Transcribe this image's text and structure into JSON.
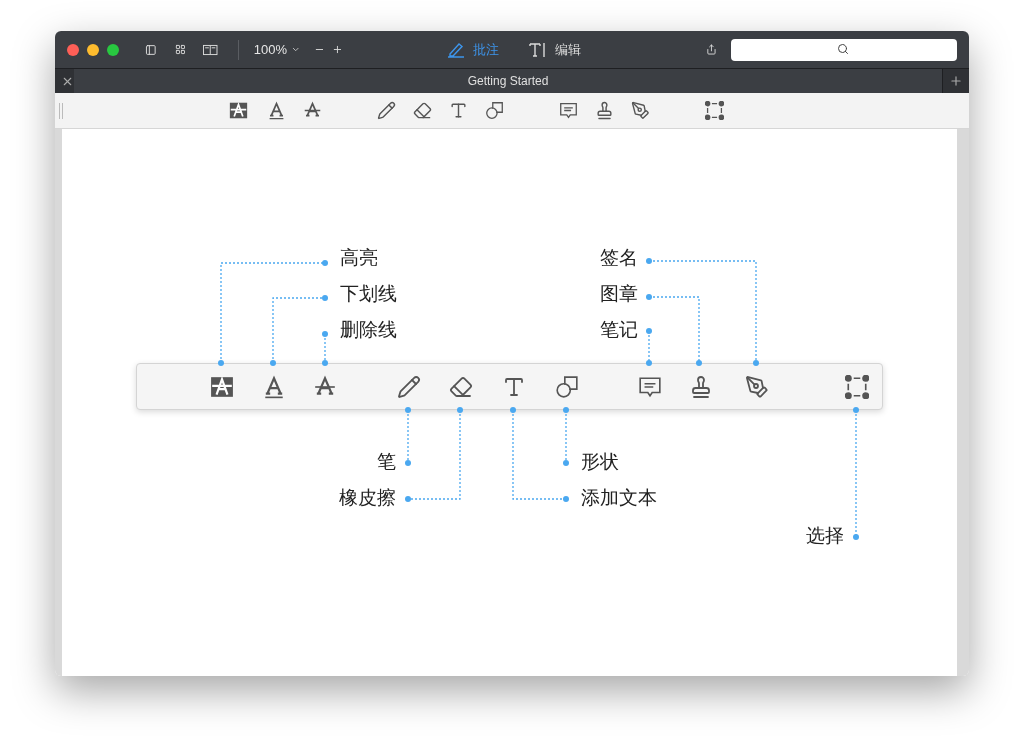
{
  "titlebar": {
    "zoom": "100%",
    "modes": [
      {
        "label": "批注",
        "selected": true
      },
      {
        "label": "编辑",
        "selected": false
      }
    ]
  },
  "tab": {
    "title": "Getting Started"
  },
  "callouts": [
    {
      "label": "高亮"
    },
    {
      "label": "下划线"
    },
    {
      "label": "删除线"
    },
    {
      "label": "签名"
    },
    {
      "label": "图章"
    },
    {
      "label": "笔记"
    },
    {
      "label": "笔"
    },
    {
      "label": "橡皮擦"
    },
    {
      "label": "形状"
    },
    {
      "label": "添加文本"
    },
    {
      "label": "选择"
    }
  ]
}
